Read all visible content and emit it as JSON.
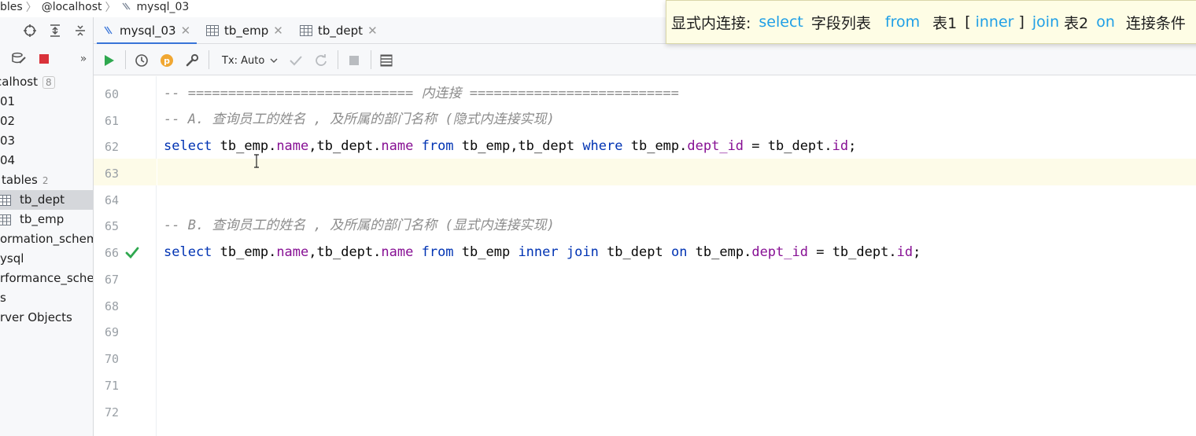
{
  "breadcrumb": {
    "items": [
      "bles",
      "@localhost",
      "mysql_03"
    ]
  },
  "tabs": [
    {
      "label": "mysql_03",
      "icon": "sql-console-icon",
      "active": true
    },
    {
      "label": "tb_emp",
      "icon": "table-icon",
      "active": false
    },
    {
      "label": "tb_dept",
      "icon": "table-icon",
      "active": false
    }
  ],
  "editor_toolbar": {
    "tx_mode": "Tx: Auto"
  },
  "tree": {
    "items": [
      {
        "label": "calhost",
        "count": "8"
      },
      {
        "label": "01"
      },
      {
        "label": "02"
      },
      {
        "label": "03"
      },
      {
        "label": "04"
      },
      {
        "label": "tables",
        "count": "2"
      },
      {
        "label": "tb_dept"
      },
      {
        "label": "tb_emp"
      },
      {
        "label": "ormation_schem"
      },
      {
        "label": "ysql"
      },
      {
        "label": "rformance_scher"
      },
      {
        "label": "s"
      },
      {
        "label": "rver Objects"
      }
    ]
  },
  "editor": {
    "line_numbers": [
      "60",
      "61",
      "62",
      "63",
      "64",
      "65",
      "66",
      "67",
      "68",
      "69",
      "70",
      "71",
      "72"
    ],
    "lines": {
      "l60": "-- ============================ 内连接 ==========================",
      "l61": "-- A. 查询员工的姓名 , 及所属的部门名称 (隐式内连接实现)",
      "l65": "-- B. 查询员工的姓名 , 及所属的部门名称 (显式内连接实现)"
    },
    "sql62": {
      "select": "select",
      "t1": " tb_emp.",
      "f1": "name",
      "t2": ",tb_dept.",
      "f2": "name",
      "s1": " ",
      "from": "from",
      "t3": " tb_emp,tb_dept ",
      "where": "where",
      "t4": " tb_emp.",
      "f3": "dept_id",
      "t5": " = tb_dept.",
      "f4": "id",
      "t6": ";"
    },
    "sql66": {
      "select": "select",
      "t1": " tb_emp.",
      "f1": "name",
      "t2": ",tb_dept.",
      "f2": "name",
      "s1": " ",
      "from": "from",
      "t3": " tb_emp ",
      "inner": "inner",
      "s2": " ",
      "join": "join",
      "t4": " tb_dept ",
      "on": "on",
      "t5": " tb_emp.",
      "f3": "dept_id",
      "t6": " = tb_dept.",
      "f4": "id",
      "t7": ";"
    }
  },
  "hint": {
    "label": "显式内连接:",
    "select": "select",
    "fields": "字段列表",
    "from": "from",
    "table1": "表1",
    "lb": "[",
    "inner": "inner",
    "rb": "]",
    "join": "join",
    "table2": "表2",
    "on": "on",
    "cond": "连接条件"
  },
  "colors": {
    "keyword": "#0033b3",
    "field": "#871094",
    "comment": "#8c8c8c",
    "hint_keyword": "#1f9fe6",
    "accent": "#3874d8",
    "run": "#2fa84f"
  }
}
